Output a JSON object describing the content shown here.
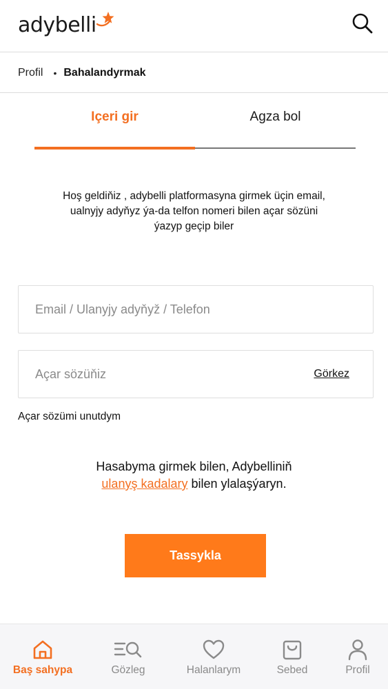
{
  "brand": {
    "name": "adybelli",
    "accent_color": "#f36f21"
  },
  "header": {
    "search_icon": "search-icon"
  },
  "breadcrumb": {
    "items": [
      "Profil",
      "Bahalandyrmak"
    ]
  },
  "tabs": [
    {
      "label": "Içeri gir",
      "active": true
    },
    {
      "label": "Agza bol",
      "active": false
    }
  ],
  "welcome_text": "Hoş geldiňiz , adybelli platformasyna girmek üçin email, ualnyjy adyňyz ýa-da telfon nomeri bilen açar sözüni ýazyp geçip biler",
  "form": {
    "email_placeholder": "Email / Ulanyjy adyňyž / Telefon",
    "email_value": "",
    "password_placeholder": "Açar sözüňiz",
    "password_value": "",
    "show_password_label": "Görkez",
    "forgot_password_label": "Açar sözümi unutdym"
  },
  "terms": {
    "prefix": "Hasabyma girmek bilen, Adybelliniň",
    "link": "ulanyş kadalary",
    "suffix": " bilen ylalaşýaryn."
  },
  "submit_label": "Tassykla",
  "bottom_nav": [
    {
      "label": "Baş sahypa",
      "icon": "home-icon",
      "active": true
    },
    {
      "label": "Gözleg",
      "icon": "search-list-icon",
      "active": false
    },
    {
      "label": "Halanlarym",
      "icon": "heart-icon",
      "active": false
    },
    {
      "label": "Sebed",
      "icon": "shopping-bag-icon",
      "active": false
    },
    {
      "label": "Profil",
      "icon": "user-icon",
      "active": false
    }
  ]
}
